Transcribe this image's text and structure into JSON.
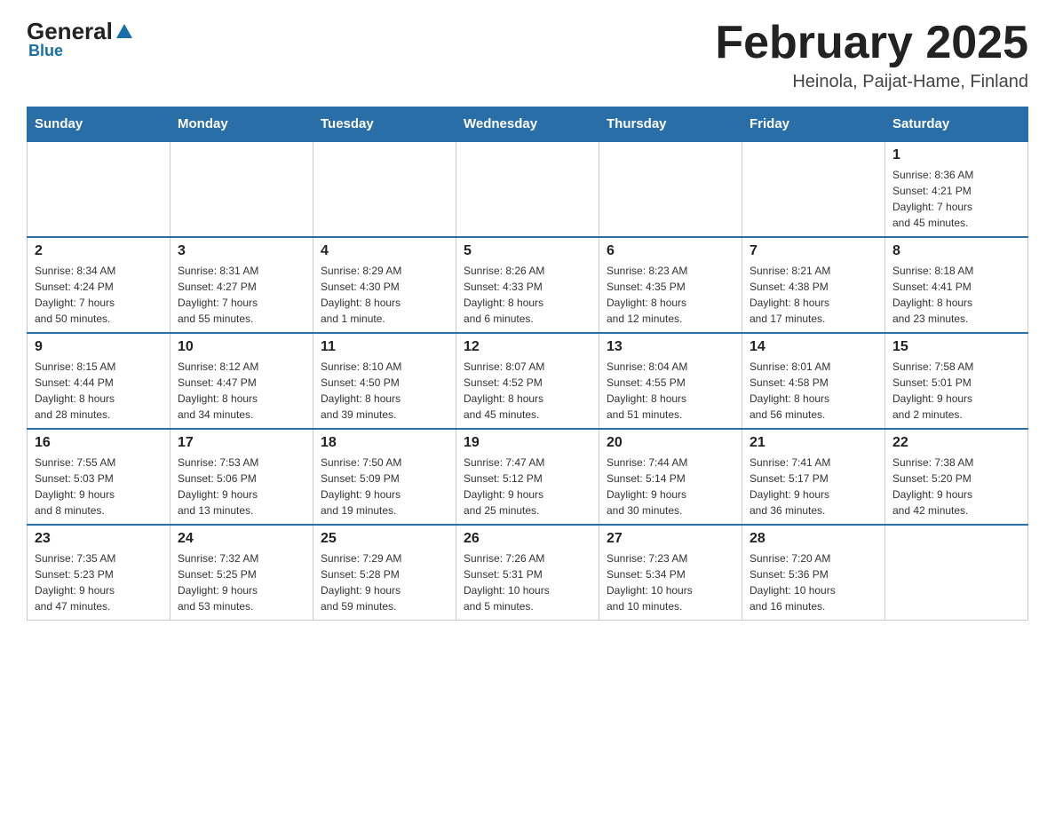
{
  "header": {
    "logo_general": "General",
    "logo_blue": "Blue",
    "month_title": "February 2025",
    "location": "Heinola, Paijat-Hame, Finland"
  },
  "days_of_week": [
    "Sunday",
    "Monday",
    "Tuesday",
    "Wednesday",
    "Thursday",
    "Friday",
    "Saturday"
  ],
  "weeks": [
    {
      "days": [
        {
          "num": "",
          "info": ""
        },
        {
          "num": "",
          "info": ""
        },
        {
          "num": "",
          "info": ""
        },
        {
          "num": "",
          "info": ""
        },
        {
          "num": "",
          "info": ""
        },
        {
          "num": "",
          "info": ""
        },
        {
          "num": "1",
          "info": "Sunrise: 8:36 AM\nSunset: 4:21 PM\nDaylight: 7 hours\nand 45 minutes."
        }
      ]
    },
    {
      "days": [
        {
          "num": "2",
          "info": "Sunrise: 8:34 AM\nSunset: 4:24 PM\nDaylight: 7 hours\nand 50 minutes."
        },
        {
          "num": "3",
          "info": "Sunrise: 8:31 AM\nSunset: 4:27 PM\nDaylight: 7 hours\nand 55 minutes."
        },
        {
          "num": "4",
          "info": "Sunrise: 8:29 AM\nSunset: 4:30 PM\nDaylight: 8 hours\nand 1 minute."
        },
        {
          "num": "5",
          "info": "Sunrise: 8:26 AM\nSunset: 4:33 PM\nDaylight: 8 hours\nand 6 minutes."
        },
        {
          "num": "6",
          "info": "Sunrise: 8:23 AM\nSunset: 4:35 PM\nDaylight: 8 hours\nand 12 minutes."
        },
        {
          "num": "7",
          "info": "Sunrise: 8:21 AM\nSunset: 4:38 PM\nDaylight: 8 hours\nand 17 minutes."
        },
        {
          "num": "8",
          "info": "Sunrise: 8:18 AM\nSunset: 4:41 PM\nDaylight: 8 hours\nand 23 minutes."
        }
      ]
    },
    {
      "days": [
        {
          "num": "9",
          "info": "Sunrise: 8:15 AM\nSunset: 4:44 PM\nDaylight: 8 hours\nand 28 minutes."
        },
        {
          "num": "10",
          "info": "Sunrise: 8:12 AM\nSunset: 4:47 PM\nDaylight: 8 hours\nand 34 minutes."
        },
        {
          "num": "11",
          "info": "Sunrise: 8:10 AM\nSunset: 4:50 PM\nDaylight: 8 hours\nand 39 minutes."
        },
        {
          "num": "12",
          "info": "Sunrise: 8:07 AM\nSunset: 4:52 PM\nDaylight: 8 hours\nand 45 minutes."
        },
        {
          "num": "13",
          "info": "Sunrise: 8:04 AM\nSunset: 4:55 PM\nDaylight: 8 hours\nand 51 minutes."
        },
        {
          "num": "14",
          "info": "Sunrise: 8:01 AM\nSunset: 4:58 PM\nDaylight: 8 hours\nand 56 minutes."
        },
        {
          "num": "15",
          "info": "Sunrise: 7:58 AM\nSunset: 5:01 PM\nDaylight: 9 hours\nand 2 minutes."
        }
      ]
    },
    {
      "days": [
        {
          "num": "16",
          "info": "Sunrise: 7:55 AM\nSunset: 5:03 PM\nDaylight: 9 hours\nand 8 minutes."
        },
        {
          "num": "17",
          "info": "Sunrise: 7:53 AM\nSunset: 5:06 PM\nDaylight: 9 hours\nand 13 minutes."
        },
        {
          "num": "18",
          "info": "Sunrise: 7:50 AM\nSunset: 5:09 PM\nDaylight: 9 hours\nand 19 minutes."
        },
        {
          "num": "19",
          "info": "Sunrise: 7:47 AM\nSunset: 5:12 PM\nDaylight: 9 hours\nand 25 minutes."
        },
        {
          "num": "20",
          "info": "Sunrise: 7:44 AM\nSunset: 5:14 PM\nDaylight: 9 hours\nand 30 minutes."
        },
        {
          "num": "21",
          "info": "Sunrise: 7:41 AM\nSunset: 5:17 PM\nDaylight: 9 hours\nand 36 minutes."
        },
        {
          "num": "22",
          "info": "Sunrise: 7:38 AM\nSunset: 5:20 PM\nDaylight: 9 hours\nand 42 minutes."
        }
      ]
    },
    {
      "days": [
        {
          "num": "23",
          "info": "Sunrise: 7:35 AM\nSunset: 5:23 PM\nDaylight: 9 hours\nand 47 minutes."
        },
        {
          "num": "24",
          "info": "Sunrise: 7:32 AM\nSunset: 5:25 PM\nDaylight: 9 hours\nand 53 minutes."
        },
        {
          "num": "25",
          "info": "Sunrise: 7:29 AM\nSunset: 5:28 PM\nDaylight: 9 hours\nand 59 minutes."
        },
        {
          "num": "26",
          "info": "Sunrise: 7:26 AM\nSunset: 5:31 PM\nDaylight: 10 hours\nand 5 minutes."
        },
        {
          "num": "27",
          "info": "Sunrise: 7:23 AM\nSunset: 5:34 PM\nDaylight: 10 hours\nand 10 minutes."
        },
        {
          "num": "28",
          "info": "Sunrise: 7:20 AM\nSunset: 5:36 PM\nDaylight: 10 hours\nand 16 minutes."
        },
        {
          "num": "",
          "info": ""
        }
      ]
    }
  ]
}
